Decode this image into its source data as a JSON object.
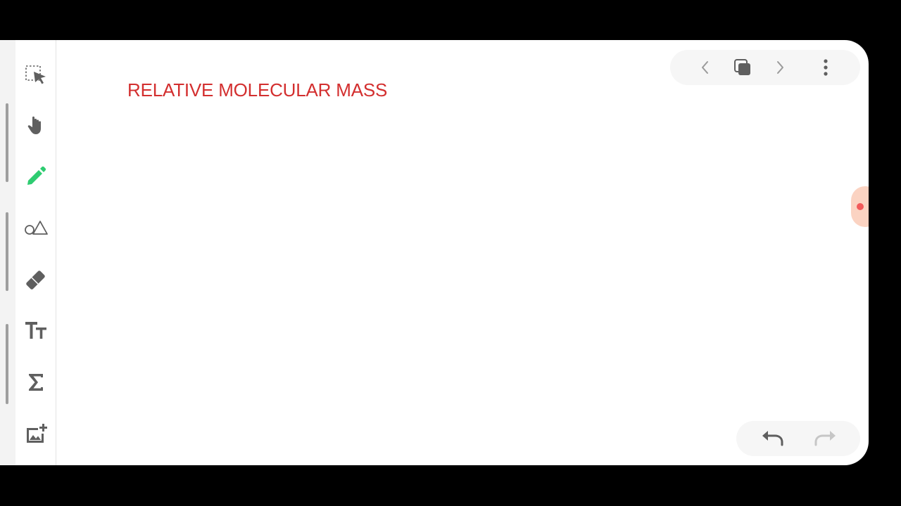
{
  "canvas": {
    "title": "RELATIVE MOLECULAR MASS",
    "title_color": "#d32f2f"
  },
  "theme": {
    "active_tool_color": "#2ecc71",
    "icon_color": "#5f5f5f",
    "disabled_icon_color": "#c6c6c6"
  },
  "toolbar": {
    "tools": [
      {
        "id": "selection",
        "icon": "selection-icon",
        "active": false
      },
      {
        "id": "hand",
        "icon": "hand-icon",
        "active": false
      },
      {
        "id": "pen",
        "icon": "pen-icon",
        "active": true
      },
      {
        "id": "shapes",
        "icon": "shapes-icon",
        "active": false
      },
      {
        "id": "eraser",
        "icon": "eraser-icon",
        "active": false
      },
      {
        "id": "text",
        "icon": "text-size-icon",
        "active": false
      },
      {
        "id": "formula",
        "icon": "sigma-icon",
        "active": false
      },
      {
        "id": "image",
        "icon": "add-image-icon",
        "active": false
      }
    ]
  },
  "page_nav": {
    "previous_icon": "chevron-left-icon",
    "pages_icon": "pages-icon",
    "next_icon": "chevron-right-icon",
    "more_icon": "more-vertical-icon"
  },
  "history": {
    "undo_icon": "undo-icon",
    "redo_icon": "redo-icon",
    "redo_enabled": false
  }
}
